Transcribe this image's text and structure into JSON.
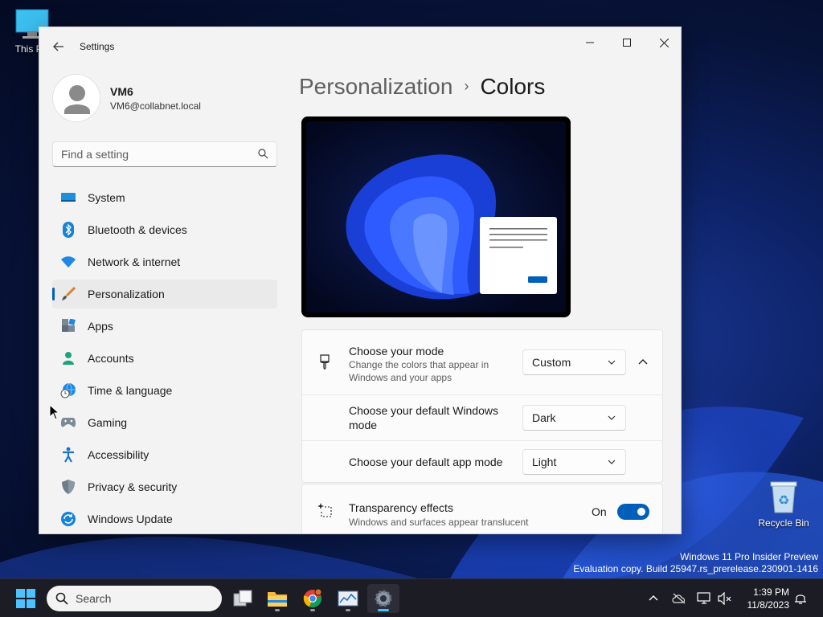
{
  "desktop": {
    "icons": [
      {
        "label": "This PC"
      },
      {
        "label": "Recycle Bin"
      }
    ],
    "watermark_line1": "Windows 11 Pro Insider Preview",
    "watermark_line2": "Evaluation copy. Build 25947.rs_prerelease.230901-1416"
  },
  "window": {
    "title": "Settings",
    "controls": [
      "minimize",
      "maximize",
      "close"
    ]
  },
  "profile": {
    "name": "VM6",
    "email": "VM6@collabnet.local"
  },
  "search": {
    "placeholder": "Find a setting",
    "value": ""
  },
  "sidebar": {
    "items": [
      {
        "label": "System",
        "icon": "system-icon",
        "active": false
      },
      {
        "label": "Bluetooth & devices",
        "icon": "bluetooth-icon",
        "active": false
      },
      {
        "label": "Network & internet",
        "icon": "wifi-icon",
        "active": false
      },
      {
        "label": "Personalization",
        "icon": "brush-icon",
        "active": true
      },
      {
        "label": "Apps",
        "icon": "apps-icon",
        "active": false
      },
      {
        "label": "Accounts",
        "icon": "accounts-icon",
        "active": false
      },
      {
        "label": "Time & language",
        "icon": "globe-clock-icon",
        "active": false
      },
      {
        "label": "Gaming",
        "icon": "gamepad-icon",
        "active": false
      },
      {
        "label": "Accessibility",
        "icon": "accessibility-icon",
        "active": false
      },
      {
        "label": "Privacy & security",
        "icon": "shield-icon",
        "active": false
      },
      {
        "label": "Windows Update",
        "icon": "update-icon",
        "active": false
      }
    ]
  },
  "breadcrumb": {
    "parent": "Personalization",
    "separator": "›",
    "current": "Colors"
  },
  "settings": {
    "mode": {
      "title": "Choose your mode",
      "description_line1": "Change the colors that appear in",
      "description_line2": "Windows and your apps",
      "value": "Custom",
      "expanded": true
    },
    "windows_mode": {
      "title_line1": "Choose your default Windows",
      "title_line2": "mode",
      "value": "Dark"
    },
    "app_mode": {
      "title": "Choose your default app mode",
      "value": "Light"
    },
    "transparency": {
      "title": "Transparency effects",
      "description": "Windows and surfaces appear translucent",
      "state_label": "On",
      "on": true
    }
  },
  "taskbar": {
    "search_placeholder": "Search",
    "apps": [
      "task-view-icon",
      "file-explorer-icon",
      "chrome-icon",
      "task-manager-icon",
      "settings-icon"
    ],
    "active_app": "settings-icon",
    "time": "1:39 PM",
    "date": "11/8/2023"
  },
  "colors": {
    "accent": "#005fb8",
    "taskbar_bg": "#1c1c24",
    "window_bg": "#f3f3f3"
  }
}
